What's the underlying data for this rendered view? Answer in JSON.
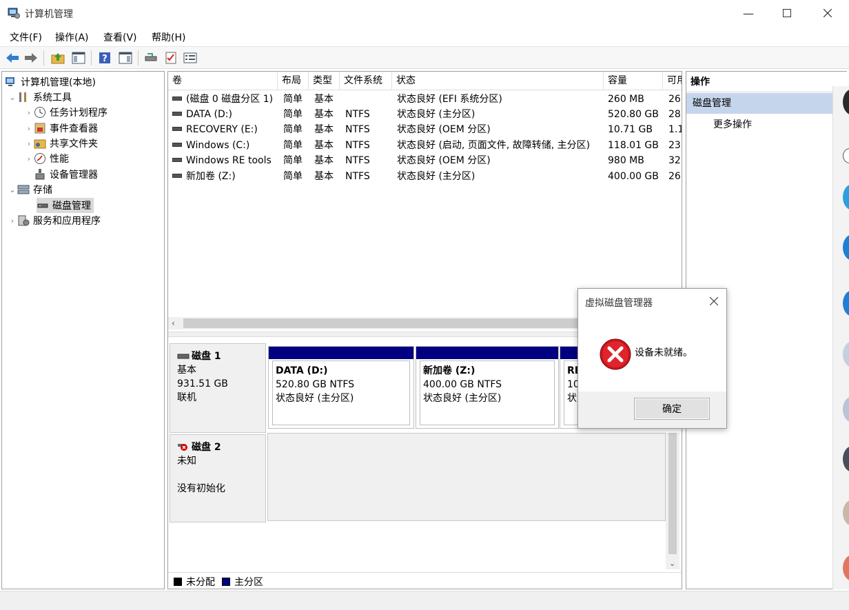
{
  "window": {
    "title": "计算机管理"
  },
  "menu": [
    "文件(F)",
    "操作(A)",
    "查看(V)",
    "帮助(H)"
  ],
  "tree": {
    "root": "计算机管理(本地)",
    "system_tools": "系统工具",
    "task_scheduler": "任务计划程序",
    "event_viewer": "事件查看器",
    "shared_folders": "共享文件夹",
    "performance": "性能",
    "device_manager": "设备管理器",
    "storage": "存储",
    "disk_management": "磁盘管理",
    "services_apps": "服务和应用程序"
  },
  "columns": [
    "卷",
    "布局",
    "类型",
    "文件系统",
    "状态",
    "容量",
    "可用"
  ],
  "volumes": [
    {
      "name": "(磁盘 0 磁盘分区 1)",
      "layout": "简单",
      "type": "基本",
      "fs": "",
      "status": "状态良好 (EFI 系统分区)",
      "capacity": "260 MB",
      "free": "26"
    },
    {
      "name": "DATA (D:)",
      "layout": "简单",
      "type": "基本",
      "fs": "NTFS",
      "status": "状态良好 (主分区)",
      "capacity": "520.80 GB",
      "free": "28"
    },
    {
      "name": "RECOVERY (E:)",
      "layout": "简单",
      "type": "基本",
      "fs": "NTFS",
      "status": "状态良好 (OEM 分区)",
      "capacity": "10.71 GB",
      "free": "1.1"
    },
    {
      "name": "Windows (C:)",
      "layout": "简单",
      "type": "基本",
      "fs": "NTFS",
      "status": "状态良好 (启动, 页面文件, 故障转储, 主分区)",
      "capacity": "118.01 GB",
      "free": "23"
    },
    {
      "name": "Windows RE tools",
      "layout": "简单",
      "type": "基本",
      "fs": "NTFS",
      "status": "状态良好 (OEM 分区)",
      "capacity": "980 MB",
      "free": "32"
    },
    {
      "name": "新加卷 (Z:)",
      "layout": "简单",
      "type": "基本",
      "fs": "NTFS",
      "status": "状态良好 (主分区)",
      "capacity": "400.00 GB",
      "free": "26"
    }
  ],
  "disk1": {
    "name": "磁盘 1",
    "type": "基本",
    "size": "931.51 GB",
    "state": "联机",
    "partitions": [
      {
        "name": "DATA  (D:)",
        "size": "520.80 GB NTFS",
        "status": "状态良好 (主分区)"
      },
      {
        "name": "新加卷  (Z:)",
        "size": "400.00 GB NTFS",
        "status": "状态良好 (主分区)"
      },
      {
        "name": "RE",
        "size": "10",
        "status": "状"
      }
    ]
  },
  "disk2": {
    "name": "磁盘 2",
    "type": "未知",
    "state": "没有初始化"
  },
  "legend": {
    "unallocated": "未分配",
    "primary": "主分区"
  },
  "actions": {
    "header": "操作",
    "section": "磁盘管理",
    "more": "更多操作"
  },
  "dialog": {
    "title": "虚拟磁盘管理器",
    "message": "设备未就绪。",
    "ok": "确定"
  },
  "colors": {
    "primary_partition": "#000080",
    "unallocated": "#000000",
    "action_section": "#c5d5ec"
  }
}
